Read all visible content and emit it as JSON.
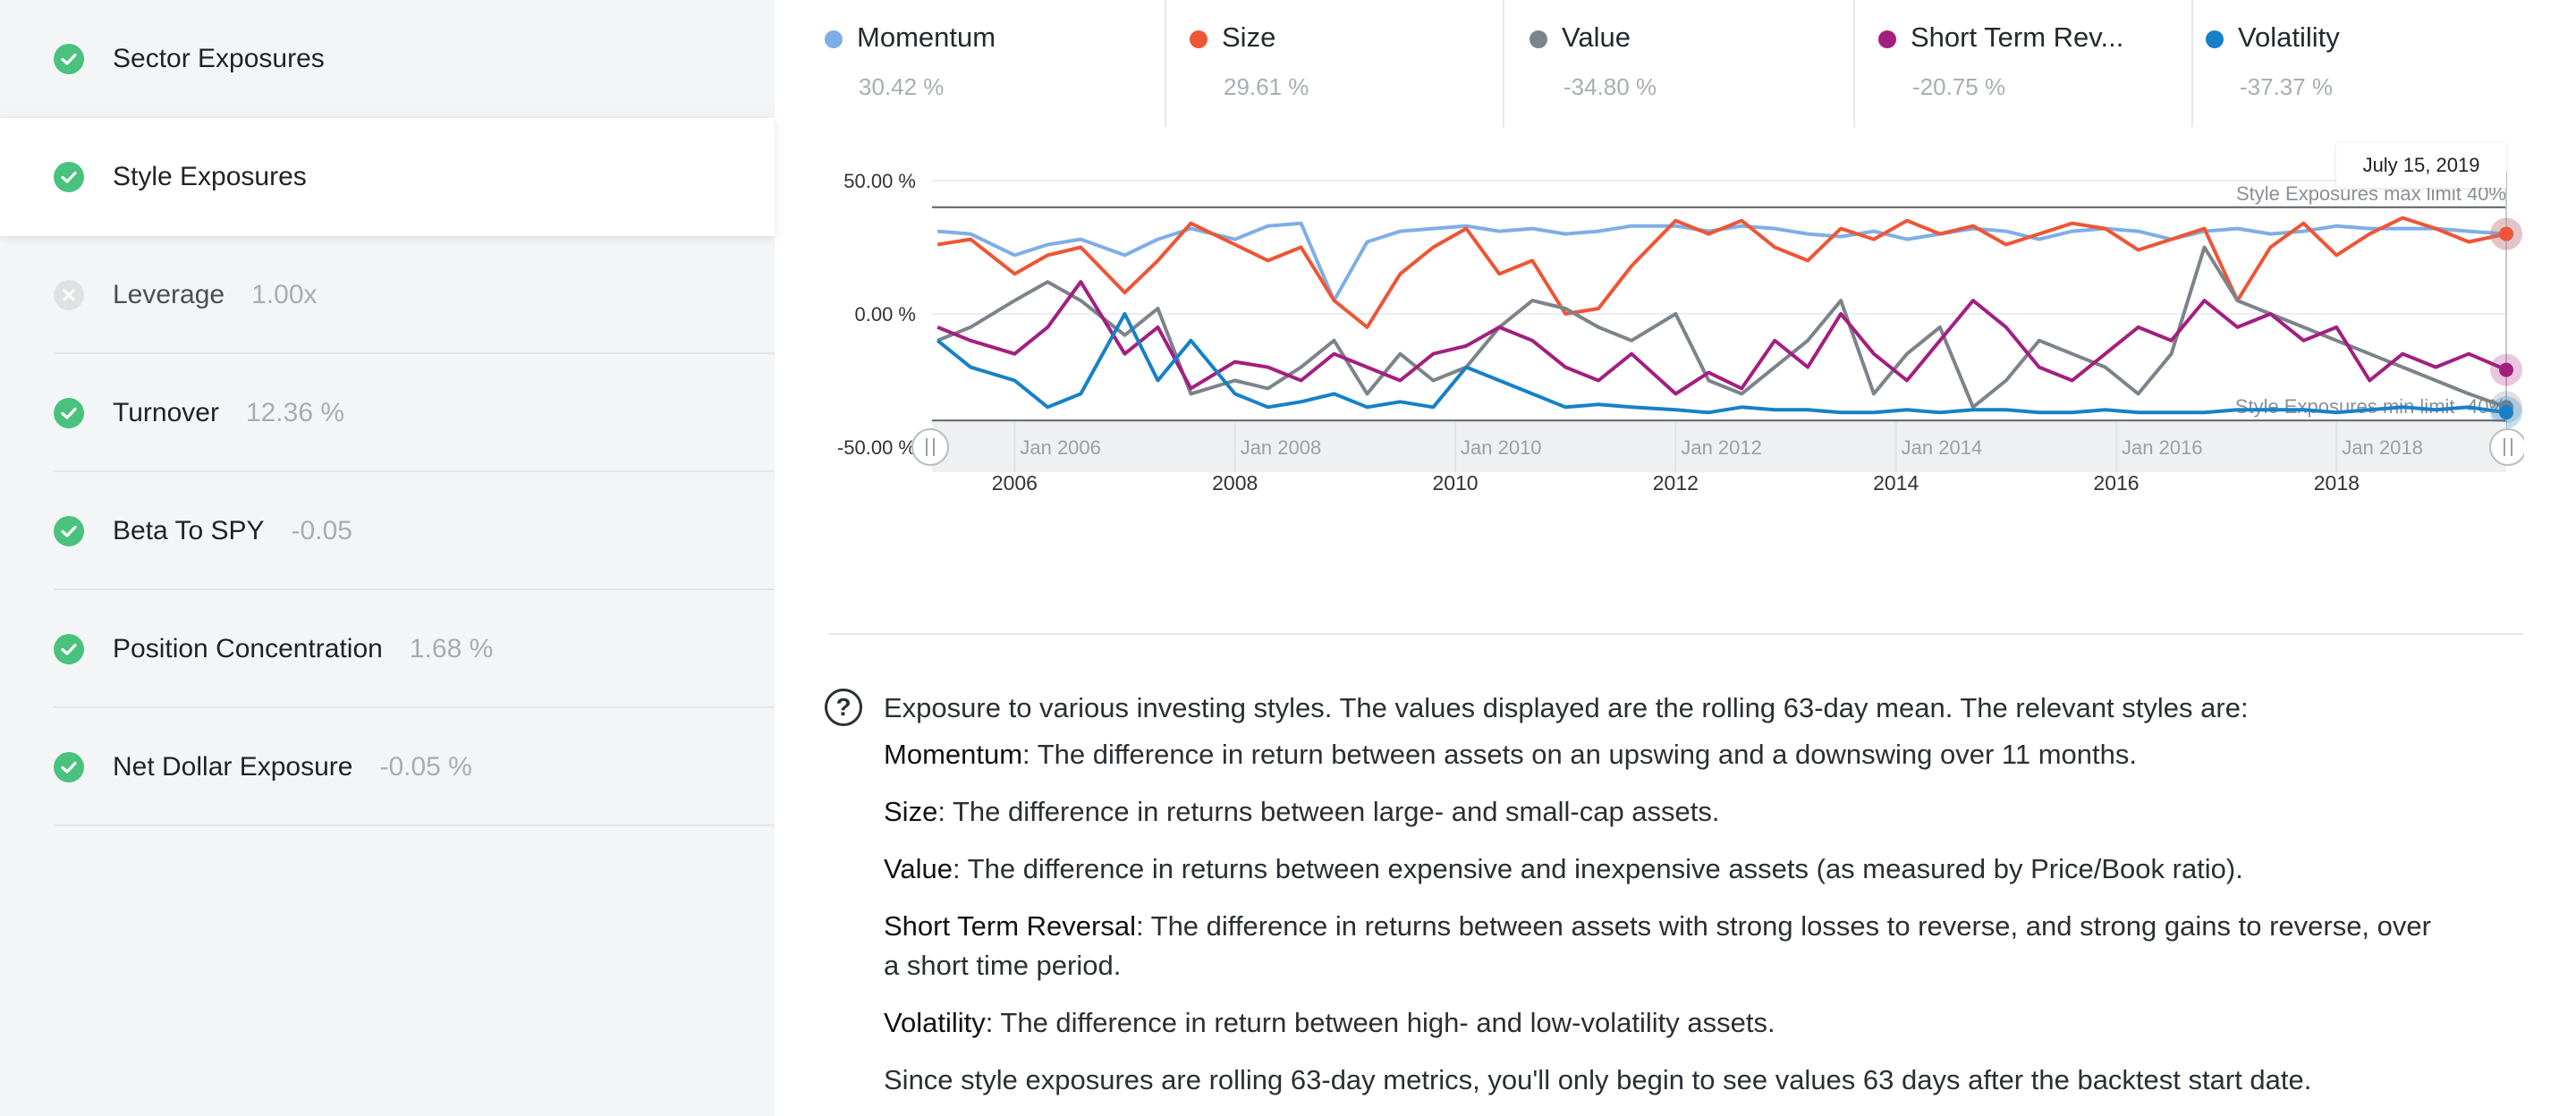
{
  "sidebar": {
    "items": [
      {
        "label": "Sector Exposures",
        "value": "",
        "status": "check",
        "selected": false
      },
      {
        "label": "Style Exposures",
        "value": "",
        "status": "check",
        "selected": true
      },
      {
        "label": "Leverage",
        "value": "1.00x",
        "status": "cross",
        "selected": false
      },
      {
        "label": "Turnover",
        "value": "12.36 %",
        "status": "check",
        "selected": false
      },
      {
        "label": "Beta To SPY",
        "value": "-0.05",
        "status": "check",
        "selected": false
      },
      {
        "label": "Position Concentration",
        "value": "1.68 %",
        "status": "check",
        "selected": false
      },
      {
        "label": "Net Dollar Exposure",
        "value": "-0.05 %",
        "status": "check",
        "selected": false
      }
    ]
  },
  "legend": [
    {
      "name": "Momentum",
      "value": "30.42 %",
      "color": "#7eaee6"
    },
    {
      "name": "Size",
      "value": "29.61 %",
      "color": "#ee5535"
    },
    {
      "name": "Value",
      "value": "-34.80 %",
      "color": "#7c838b"
    },
    {
      "name": "Short Term Rev...",
      "value": "-20.75 %",
      "color": "#a31f7f"
    },
    {
      "name": "Volatility",
      "value": "-37.37 %",
      "color": "#1681c8"
    }
  ],
  "chart_data": {
    "type": "line",
    "title": "",
    "xlabel": "",
    "ylabel": "",
    "xlim": [
      2005.25,
      2019.54
    ],
    "ylim": [
      -50,
      50
    ],
    "y_ticks": [
      "50.00 %",
      "0.00 %",
      "-50.00 %"
    ],
    "y_tick_values": [
      50,
      0,
      -50
    ],
    "x_ticks": [
      "2006",
      "2008",
      "2010",
      "2012",
      "2014",
      "2016",
      "2018"
    ],
    "x_tick_values": [
      2006,
      2008,
      2010,
      2012,
      2014,
      2016,
      2018
    ],
    "limits": {
      "max": {
        "value": 40,
        "label": "Style Exposures max limit 40%"
      },
      "min": {
        "value": -40,
        "label": "Style Exposures min limit -40%"
      }
    },
    "tooltip": "July 15, 2019",
    "navigator_labels": [
      "Jan 2006",
      "Jan 2008",
      "Jan 2010",
      "Jan 2012",
      "Jan 2014",
      "Jan 2016",
      "Jan 2018"
    ],
    "grid": true,
    "x": [
      2005.3,
      2005.6,
      2006.0,
      2006.3,
      2006.6,
      2007.0,
      2007.3,
      2007.6,
      2008.0,
      2008.3,
      2008.6,
      2008.9,
      2009.2,
      2009.5,
      2009.8,
      2010.1,
      2010.4,
      2010.7,
      2011.0,
      2011.3,
      2011.6,
      2012.0,
      2012.3,
      2012.6,
      2012.9,
      2013.2,
      2013.5,
      2013.8,
      2014.1,
      2014.4,
      2014.7,
      2015.0,
      2015.3,
      2015.6,
      2015.9,
      2016.2,
      2016.5,
      2016.8,
      2017.1,
      2017.4,
      2017.7,
      2018.0,
      2018.3,
      2018.6,
      2018.9,
      2019.2,
      2019.54
    ],
    "series": [
      {
        "name": "Momentum",
        "color": "#7eaee6",
        "values": [
          31,
          30,
          22,
          26,
          28,
          22,
          28,
          32,
          28,
          33,
          34,
          5,
          27,
          31,
          32,
          33,
          31,
          32,
          30,
          31,
          33,
          33,
          31,
          33,
          32,
          30,
          29,
          31,
          28,
          30,
          32,
          31,
          28,
          31,
          32,
          31,
          28,
          31,
          32,
          30,
          31,
          33,
          32,
          32,
          32,
          31,
          30
        ]
      },
      {
        "name": "Size",
        "color": "#ee5535",
        "values": [
          26,
          28,
          15,
          22,
          25,
          8,
          20,
          34,
          26,
          20,
          25,
          5,
          -5,
          15,
          25,
          32,
          15,
          20,
          0,
          2,
          18,
          35,
          30,
          35,
          25,
          20,
          32,
          28,
          35,
          30,
          33,
          26,
          30,
          34,
          32,
          24,
          28,
          32,
          5,
          25,
          34,
          22,
          30,
          36,
          32,
          27,
          30
        ]
      },
      {
        "name": "Value",
        "color": "#7c838b",
        "values": [
          -10,
          -5,
          5,
          12,
          5,
          -8,
          2,
          -30,
          -25,
          -28,
          -20,
          -10,
          -30,
          -15,
          -25,
          -20,
          -5,
          5,
          2,
          -5,
          -10,
          0,
          -25,
          -30,
          -20,
          -10,
          5,
          -30,
          -15,
          -5,
          -35,
          -25,
          -10,
          -15,
          -20,
          -30,
          -15,
          25,
          5,
          0,
          -5,
          -10,
          -15,
          -20,
          -25,
          -30,
          -35
        ]
      },
      {
        "name": "Short Term Reversal",
        "color": "#a31f7f",
        "values": [
          -5,
          -10,
          -15,
          -5,
          12,
          -15,
          -5,
          -28,
          -18,
          -20,
          -25,
          -15,
          -20,
          -25,
          -15,
          -12,
          -5,
          -10,
          -20,
          -25,
          -15,
          -30,
          -22,
          -28,
          -10,
          -20,
          0,
          -15,
          -25,
          -10,
          5,
          -5,
          -20,
          -25,
          -15,
          -5,
          -10,
          5,
          -5,
          0,
          -10,
          -5,
          -25,
          -15,
          -20,
          -15,
          -21
        ]
      },
      {
        "name": "Volatility",
        "color": "#1681c8",
        "values": [
          -10,
          -20,
          -25,
          -35,
          -30,
          0,
          -25,
          -10,
          -30,
          -35,
          -33,
          -30,
          -35,
          -33,
          -35,
          -20,
          -25,
          -30,
          -35,
          -34,
          -35,
          -36,
          -37,
          -35,
          -36,
          -36,
          -37,
          -37,
          -36,
          -37,
          -36,
          -36,
          -37,
          -37,
          -36,
          -37,
          -37,
          -37,
          -36,
          -36,
          -36,
          -37,
          -36,
          -35,
          -36,
          -35,
          -37
        ]
      }
    ]
  },
  "description": {
    "intro": "Exposure to various investing styles. The values displayed are the rolling 63-day mean. The relevant styles are:",
    "definitions": [
      {
        "term": "Momentum",
        "text": ": The difference in return between assets on an upswing and a downswing over 11 months."
      },
      {
        "term": "Size",
        "text": ": The difference in returns between large- and small-cap assets."
      },
      {
        "term": "Value",
        "text": ": The difference in returns between expensive and inexpensive assets (as measured by Price/Book ratio)."
      },
      {
        "term": "Short Term Reversal",
        "text": ": The difference in returns between assets with strong losses to reverse, and strong gains to reverse, over a short time period."
      },
      {
        "term": "Volatility",
        "text": ": The difference in return between high- and low-volatility assets."
      }
    ],
    "footer": "Since style exposures are rolling 63-day metrics, you'll only begin to see values 63 days after the backtest start date."
  }
}
